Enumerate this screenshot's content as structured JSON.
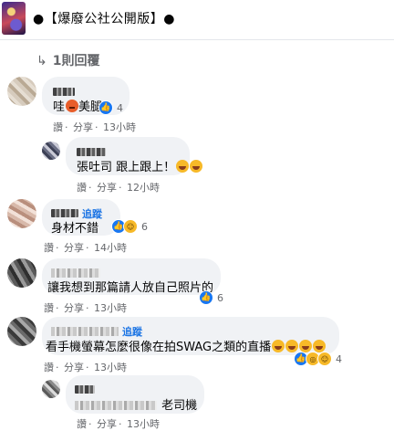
{
  "header": {
    "title": "●【爆廢公社公開版】●"
  },
  "replies_link": {
    "arrow": "↳",
    "label": "1則回覆"
  },
  "actions": {
    "like": "讚",
    "dot": "·",
    "reply": "分享",
    "sep": "·"
  },
  "comments": [
    {
      "id": "c1",
      "name_redacted": true,
      "follow_label": "",
      "text_before": "哇",
      "text_after": "美腿",
      "time": "13小時",
      "reactions": [
        "like"
      ],
      "reaction_count": "4"
    },
    {
      "id": "c1r",
      "name_redacted": true,
      "follow_label": "",
      "text": "張吐司 跟上跟上！",
      "time": "12小時",
      "reactions": [],
      "reaction_count": ""
    },
    {
      "id": "c2",
      "name_redacted": true,
      "follow_label": "追蹤",
      "text": "身材不錯",
      "time": "14小時",
      "reactions": [
        "like",
        "haha"
      ],
      "reaction_count": "6"
    },
    {
      "id": "c3",
      "name_redacted": true,
      "follow_label": "",
      "text": "讓我想到那篇請人放自己照片的",
      "time": "13小時",
      "reactions": [
        "like"
      ],
      "reaction_count": "6"
    },
    {
      "id": "c4",
      "name_redacted": true,
      "follow_label": "追蹤",
      "text": "看手機螢幕怎麼很像在拍SWAG之類的直播",
      "time": "13小時",
      "reactions": [
        "like",
        "wow",
        "haha"
      ],
      "reaction_count": "4"
    },
    {
      "id": "c4r",
      "name_redacted": true,
      "follow_label": "",
      "text": "老司機",
      "time": "13小時",
      "reactions": [],
      "reaction_count": ""
    }
  ],
  "colors": {
    "link": "#1b74e4",
    "bubble": "#f0f2f5",
    "meta": "#65676b",
    "like": "#1877f2",
    "emoji": "#f7b928"
  }
}
